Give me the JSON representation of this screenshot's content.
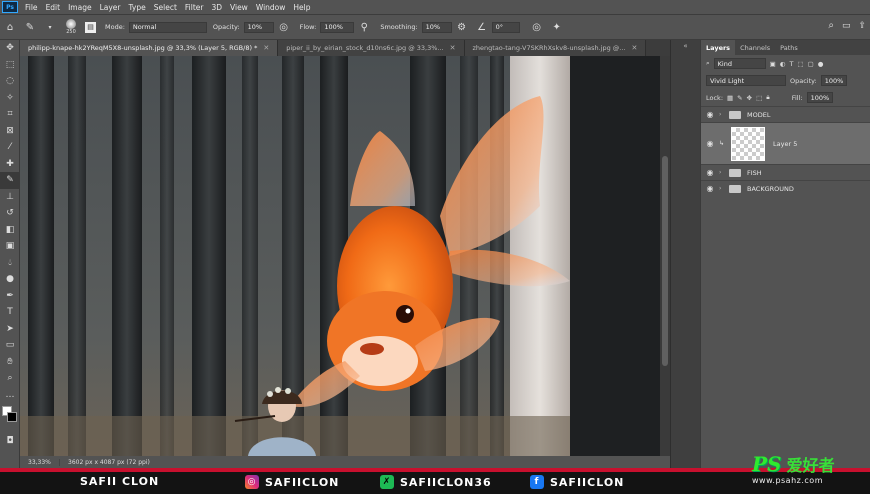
{
  "menu": {
    "logo": "Ps",
    "items": [
      "File",
      "Edit",
      "Image",
      "Layer",
      "Type",
      "Select",
      "Filter",
      "3D",
      "View",
      "Window",
      "Help"
    ]
  },
  "options": {
    "brush_size": "250",
    "mode_label": "Mode:",
    "mode_value": "Normal",
    "opacity_label": "Opacity:",
    "opacity_value": "10%",
    "flow_label": "Flow:",
    "flow_value": "100%",
    "smoothing_label": "Smoothing:",
    "smoothing_value": "10%",
    "angle_value": "0°"
  },
  "tabs": [
    {
      "label": "philipp-knape-hk2YReqM5X8-unsplash.jpg @ 33,3% (Layer 5, RGB/8) *",
      "active": true
    },
    {
      "label": "piper_ii_by_eirian_stock_d10ns6c.jpg @ 33,3%...",
      "active": false
    },
    {
      "label": "zhengtao-tang-V7SKRhXskv8-unsplash.jpg @...",
      "active": false
    }
  ],
  "status": {
    "zoom": "33,33%",
    "dims": "3602 px x 4087 px (72 ppi)"
  },
  "panel": {
    "tabs": [
      "Layers",
      "Channels",
      "Paths"
    ],
    "kind_label": "Kind",
    "blend_mode": "Vivid Light",
    "opacity_label": "Opacity:",
    "opacity_value": "100%",
    "lock_label": "Lock:",
    "fill_label": "Fill:",
    "fill_value": "100%",
    "layers": [
      {
        "name": "MODEL",
        "type": "group"
      },
      {
        "name": "Layer 5",
        "type": "layer",
        "selected": true
      },
      {
        "name": "FISH",
        "type": "group"
      },
      {
        "name": "BACKGROUND",
        "type": "group"
      }
    ]
  },
  "banner": {
    "name": "SAFII CLON",
    "instagram": "SAFIICLON",
    "other": "SAFIICLON36",
    "facebook": "SAFIICLON"
  },
  "watermark": {
    "ps": "PS",
    "cn": "爱好者",
    "url": "www.psahz.com"
  },
  "colors": {
    "accent": "#31a8ff",
    "banner_red": "#c8102e",
    "panel": "#535353"
  }
}
